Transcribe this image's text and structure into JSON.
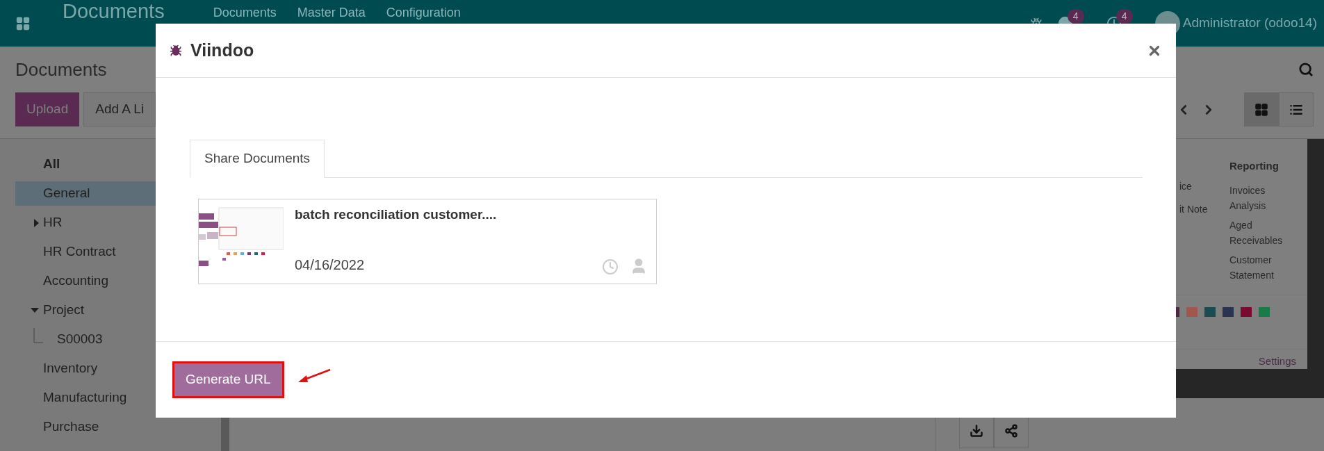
{
  "navbar": {
    "app_title": "Documents",
    "menus": [
      "Documents",
      "Master Data",
      "Configuration"
    ],
    "messages_count": "4",
    "activities_count": "4",
    "user": "Administrator (odoo14)"
  },
  "control_panel": {
    "breadcrumb": "Documents",
    "buttons": [
      "Upload",
      "Add A Li"
    ],
    "views": [
      {
        "kind": "kanban",
        "selected": true
      },
      {
        "kind": "list",
        "selected": false
      }
    ]
  },
  "sidebar": {
    "items": [
      {
        "label": "All",
        "kind": "all",
        "selected": false
      },
      {
        "label": "General",
        "kind": "folder",
        "selected": true
      },
      {
        "label": "HR",
        "kind": "folder",
        "selected": false,
        "expanded": false
      },
      {
        "label": "HR Contract",
        "kind": "folder",
        "selected": false
      },
      {
        "label": "Accounting",
        "kind": "folder",
        "selected": false
      },
      {
        "label": "Project",
        "kind": "folder",
        "selected": false,
        "expanded": true,
        "children": [
          {
            "label": "S00003",
            "kind": "folder",
            "selected": false
          }
        ]
      },
      {
        "label": "Inventory",
        "kind": "folder",
        "selected": false
      },
      {
        "label": "Manufacturing",
        "kind": "folder",
        "selected": false
      },
      {
        "label": "Purchase",
        "kind": "folder",
        "selected": false
      }
    ]
  },
  "preview": {
    "column_fragments": [
      "ice",
      "it Note"
    ],
    "reporting": {
      "heading": "Reporting",
      "items": [
        "Invoices Analysis",
        "Aged Receivables",
        "Customer Statement"
      ]
    },
    "swatches": [
      {
        "color": "#4a2a3e"
      },
      {
        "color": "#a0584e"
      },
      {
        "color": "#1a4c50"
      },
      {
        "color": "#2a3350"
      },
      {
        "color": "#7a0a32"
      },
      {
        "color": "#1a7a48"
      }
    ],
    "settings_link": "Settings"
  },
  "dialog": {
    "title": "Viindoo",
    "tabs": [
      {
        "label": "Share Documents",
        "selected": true
      }
    ],
    "documents": [
      {
        "name": "batch reconciliation customer....",
        "date": "04/16/2022"
      }
    ],
    "primary_button": "Generate URL"
  }
}
